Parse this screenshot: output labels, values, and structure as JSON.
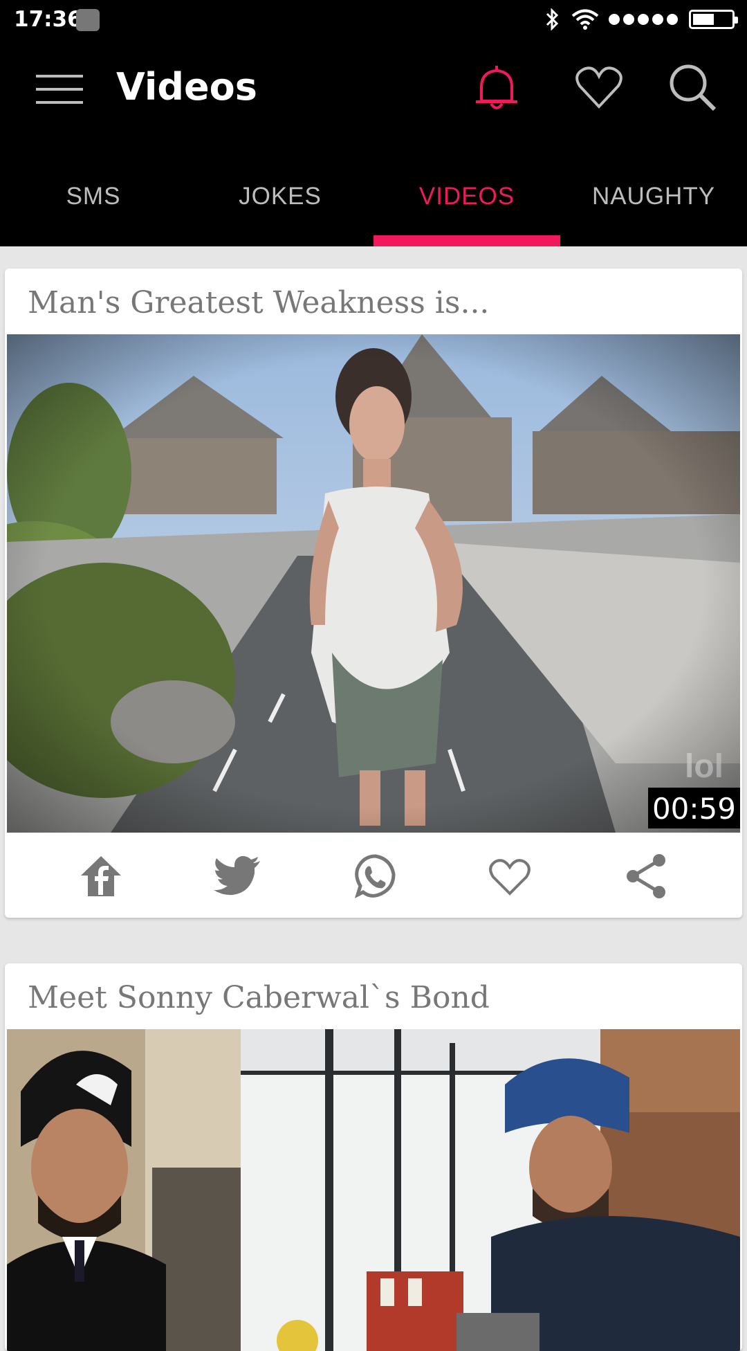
{
  "status": {
    "time": "17:36",
    "icons": [
      "screenshot-icon",
      "bluetooth-icon",
      "wifi-icon",
      "signal-dots-icon",
      "battery-icon"
    ]
  },
  "header": {
    "title": "Videos",
    "icons": [
      "menu-icon",
      "bell-icon",
      "heart-icon",
      "search-icon"
    ]
  },
  "tabs": [
    {
      "label": "SMS"
    },
    {
      "label": "JOKES"
    },
    {
      "label": "VIDEOS"
    },
    {
      "label": "NAUGHTY"
    }
  ],
  "active_tab": "VIDEOS",
  "colors": {
    "accent": "#f0195b",
    "bar_background": "#000000",
    "feed_background": "#e6e6e6",
    "icon_gray": "#777777"
  },
  "videos": [
    {
      "title": "Man's Greatest Weakness is...",
      "duration": "00:59",
      "thumbnail_watermark": "lol",
      "share_icons": [
        "facebook-icon",
        "twitter-icon",
        "whatsapp-icon",
        "heart-outline-icon",
        "share-icon"
      ]
    },
    {
      "title": "Meet Sonny Caberwal`s Bond"
    }
  ]
}
